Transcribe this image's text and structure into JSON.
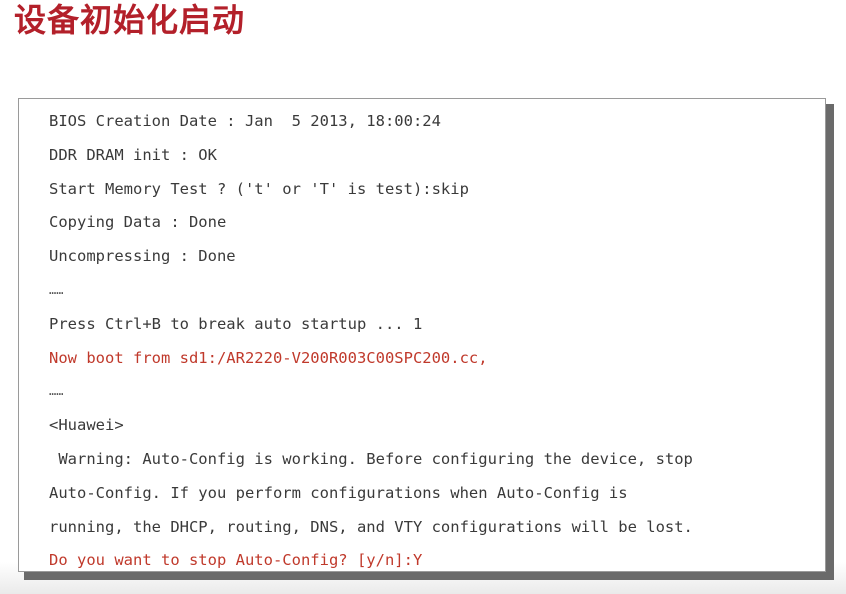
{
  "slide": {
    "title": "设备初始化启动"
  },
  "console": {
    "lines": [
      {
        "text": "BIOS Creation Date : Jan  5 2013, 18:00:24",
        "color": "#3a3a3a"
      },
      {
        "text": "DDR DRAM init : OK",
        "color": "#3a3a3a"
      },
      {
        "text": "Start Memory Test ? ('t' or 'T' is test):skip",
        "color": "#3a3a3a"
      },
      {
        "text": "Copying Data : Done",
        "color": "#3a3a3a"
      },
      {
        "text": "Uncompressing : Done",
        "color": "#3a3a3a"
      },
      {
        "text": "……",
        "color": "#555555"
      },
      {
        "text": "Press Ctrl+B to break auto startup ... 1",
        "color": "#3a3a3a"
      },
      {
        "text": "Now boot from sd1:/AR2220-V200R003C00SPC200.cc,",
        "color": "#c0392b"
      },
      {
        "text": "……",
        "color": "#555555"
      },
      {
        "text": "<Huawei>",
        "color": "#3a3a3a"
      },
      {
        "text": " Warning: Auto-Config is working. Before configuring the device, stop",
        "color": "#3a3a3a"
      },
      {
        "text": "Auto-Config. If you perform configurations when Auto-Config is",
        "color": "#3a3a3a"
      },
      {
        "text": "running, the DHCP, routing, DNS, and VTY configurations will be lost.",
        "color": "#3a3a3a"
      },
      {
        "text": "Do you want to stop Auto-Config? [y/n]:Y",
        "color": "#c0392b"
      }
    ]
  },
  "colors": {
    "title": "#b3202a",
    "console_text": "#3a3a3a",
    "console_highlight": "#c0392b"
  }
}
